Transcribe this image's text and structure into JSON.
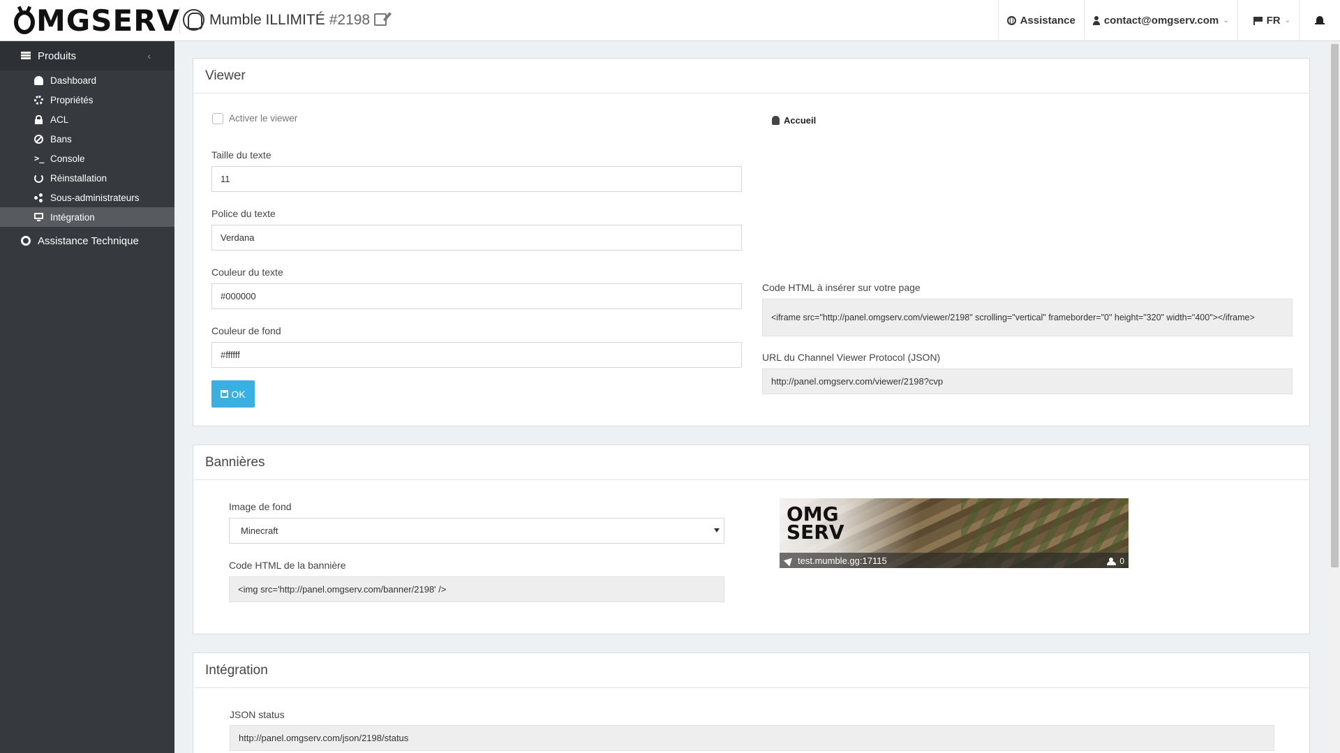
{
  "header": {
    "brand": "OMGSERV",
    "brand_letter": "MGSERV",
    "product_name": "Mumble ILLIMITÉ",
    "product_id": "#2198",
    "nav": {
      "assistance": "Assistance",
      "email": "contact@omgserv.com",
      "lang": "FR"
    }
  },
  "sidebar": {
    "section": "Produits",
    "items": [
      {
        "label": "Dashboard",
        "icon": "dashboard-icon"
      },
      {
        "label": "Propriétés",
        "icon": "gear-icon"
      },
      {
        "label": "ACL",
        "icon": "lock-icon"
      },
      {
        "label": "Bans",
        "icon": "ban-icon"
      },
      {
        "label": "Console",
        "icon": "terminal-icon"
      },
      {
        "label": "Réinstallation",
        "icon": "refresh-icon"
      },
      {
        "label": "Sous-administrateurs",
        "icon": "share-icon"
      },
      {
        "label": "Intégration",
        "icon": "monitor-icon",
        "active": true
      }
    ],
    "section2": "Assistance Technique"
  },
  "viewer": {
    "title": "Viewer",
    "enable_label": "Activer le viewer",
    "text_size_label": "Taille du texte",
    "text_size": "11",
    "font_label": "Police du texte",
    "font": "Verdana",
    "text_color_label": "Couleur du texte",
    "text_color": "#000000",
    "bg_color_label": "Couleur de fond",
    "bg_color": "#ffffff",
    "ok": "OK",
    "preview_root": "Accueil",
    "html_code_label": "Code HTML à insérer sur votre page",
    "html_code": "<iframe src=\"http://panel.omgserv.com/viewer/2198\" scrolling=\"vertical\" frameborder=\"0\" height=\"320\" width=\"400\"></iframe>",
    "cvp_label": "URL du Channel Viewer Protocol (JSON)",
    "cvp_url": "http://panel.omgserv.com/viewer/2198?cvp"
  },
  "banners": {
    "title": "Bannières",
    "bg_label": "Image de fond",
    "bg_value": "Minecraft",
    "code_label": "Code HTML de la bannière",
    "code": "<img src='http://panel.omgserv.com/banner/2198' />",
    "preview": {
      "logo_line1": "OMG",
      "logo_line2": "SERV",
      "address": "test.mumble.gg:17115",
      "count": "0"
    }
  },
  "integration": {
    "title": "Intégration",
    "json_label": "JSON status",
    "json_url": "http://panel.omgserv.com/json/2198/status"
  }
}
